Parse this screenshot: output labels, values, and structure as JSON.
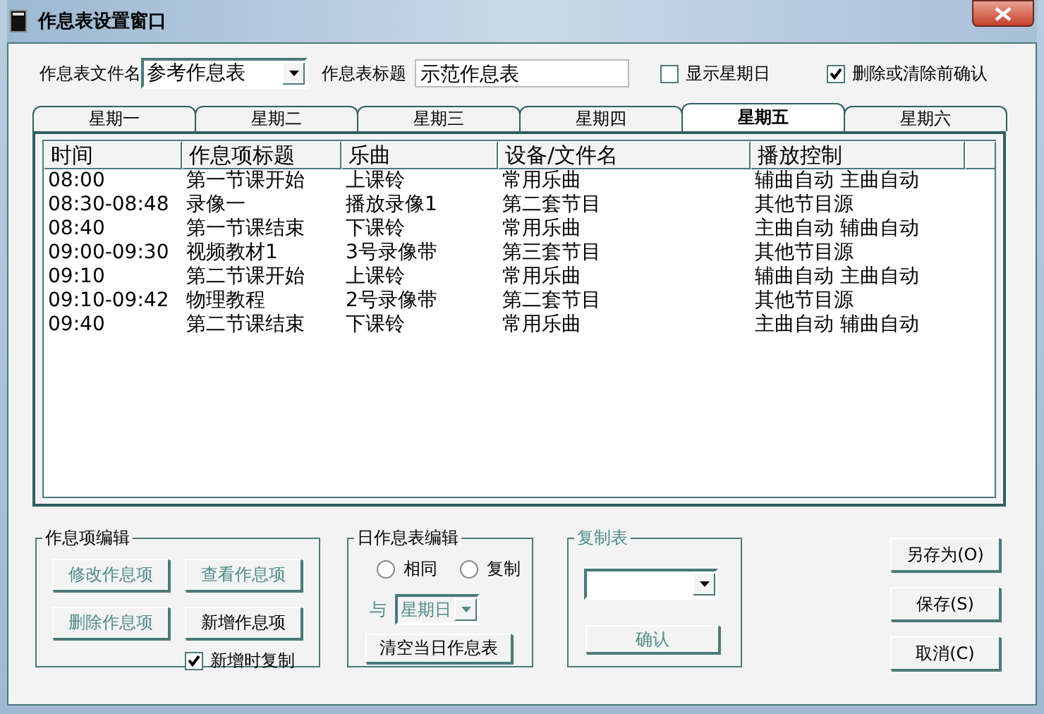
{
  "window": {
    "title": "作息表设置窗口"
  },
  "header": {
    "file_label": "作息表文件名",
    "file_value": "参考作息表",
    "title_label": "作息表标题",
    "title_value": "示范作息表",
    "options": [
      {
        "label": "显示星期日",
        "checked": false
      },
      {
        "label": "删除或清除前确认",
        "checked": true
      }
    ]
  },
  "tabs": [
    {
      "label": "星期一",
      "selected": false
    },
    {
      "label": "星期二",
      "selected": false
    },
    {
      "label": "星期三",
      "selected": false
    },
    {
      "label": "星期四",
      "selected": false
    },
    {
      "label": "星期五",
      "selected": true
    },
    {
      "label": "星期六",
      "selected": false
    }
  ],
  "table": {
    "columns": [
      "时间",
      "作息项标题",
      "乐曲",
      "设备/文件名",
      "播放控制"
    ],
    "rows": [
      [
        "08:00",
        "第一节课开始",
        "上课铃",
        "常用乐曲",
        "辅曲自动 主曲自动"
      ],
      [
        "08:30-08:48",
        "录像一",
        "播放录像1",
        "第二套节目",
        "其他节目源"
      ],
      [
        "08:40",
        "第一节课结束",
        "下课铃",
        "常用乐曲",
        "主曲自动 辅曲自动"
      ],
      [
        "09:00-09:30",
        "视频教材1",
        "3号录像带",
        "第三套节目",
        "其他节目源"
      ],
      [
        "09:10",
        "第二节课开始",
        "上课铃",
        "常用乐曲",
        "辅曲自动 主曲自动"
      ],
      [
        "09:10-09:42",
        "物理教程",
        "2号录像带",
        "第二套节目",
        "其他节目源"
      ],
      [
        "09:40",
        "第二节课结束",
        "下课铃",
        "常用乐曲",
        "主曲自动 辅曲自动"
      ]
    ]
  },
  "item_edit": {
    "title": "作息项编辑",
    "buttons": [
      {
        "label": "修改作息项",
        "disabled": true
      },
      {
        "label": "查看作息项",
        "disabled": true
      },
      {
        "label": "删除作息项",
        "disabled": true
      },
      {
        "label": "新增作息项",
        "disabled": false
      }
    ],
    "copy_on_add": {
      "label": "新增时复制",
      "checked": true
    }
  },
  "day_edit": {
    "title": "日作息表编辑",
    "radios": [
      {
        "label": "相同",
        "selected": false
      },
      {
        "label": "复制",
        "selected": false
      }
    ],
    "with_label": "与",
    "with_value": "星期日",
    "with_disabled": true,
    "clear_button": "清空当日作息表"
  },
  "copy_table": {
    "title": "复制表",
    "disabled": true,
    "confirm_button": "确认"
  },
  "actions": [
    "另存为(O)",
    "保存(S)",
    "取消(C)"
  ]
}
